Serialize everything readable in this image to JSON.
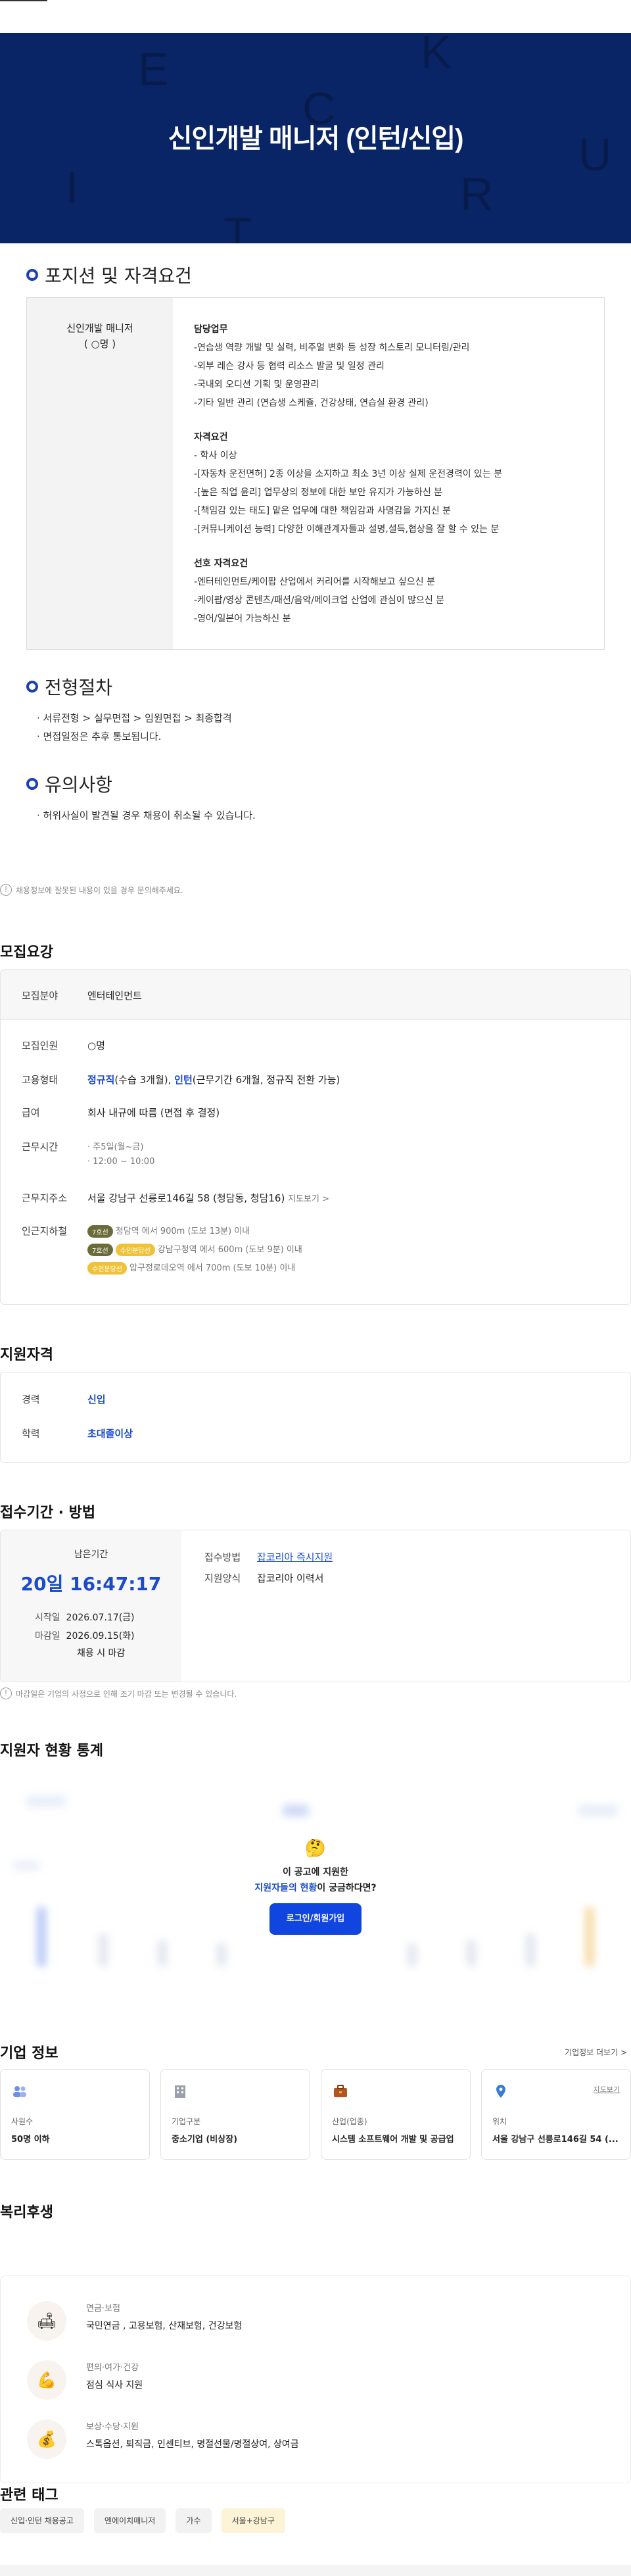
{
  "hero_title": "신인개발 매니저 (인턴/신입)",
  "hero_bg_letters": [
    "E",
    "K",
    "C",
    "U",
    "I",
    "R",
    "T"
  ],
  "sections": {
    "position": "포지션 및 자격요건",
    "process": "전형절차",
    "notice": "유의사항"
  },
  "position": {
    "name": "신인개발 매니저",
    "count": "( ○명 )",
    "duty_title": "담당업무",
    "duties": [
      "-연습생 역량 개발 및 실력, 비주얼 변화 등 성장 히스토리 모니터링/관리",
      "-외부 레슨 강사 등 협력 리소스 발굴 및 일정 관리",
      "-국내외 오디션 기획 및 운영관리",
      "-기타 일반 관리 (연습생 스케쥴, 건강상태, 연습실 환경 관리)"
    ],
    "req_title": "자격요건",
    "reqs": [
      "- 학사 이상",
      "-[자동차 운전면허] 2종 이상을 소지하고 최소 3년 이상 실제 운전경력이 있는 분",
      "-[높은 직업 윤리] 업무상의 정보에 대한 보안 유지가 가능하신 분",
      "-[책임감 있는 태도] 맡은 업무에 대한 책임감과 사명감을 가지신 분",
      "-[커뮤니케이션 능력] 다양한 이해관계자들과 설명,설득,협상을 잘 할 수 있는 분"
    ],
    "pref_title": "선호 자격요건",
    "prefs": [
      "-엔터테인먼트/케이팝 산업에서 커리어를 시작해보고 싶으신 분",
      "-케이팝/영상 콘텐츠/패션/음악/메이크업 산업에 관심이 많으신 분",
      "-영어/일본어 가능하신 분"
    ]
  },
  "process_lines": [
    "· 서류전형 > 실무면접 > 임원면접 > 최종합격",
    "· 면접일정은 추후 통보됩니다."
  ],
  "notice_lines": [
    "· 허위사실이 발견될 경우 채용이 취소될 수 있습니다."
  ],
  "report_note": "채용정보에 잘못된 내용이 있을 경우 문의해주세요.",
  "recruit": {
    "title": "모집요강",
    "field_label": "모집분야",
    "field_value": "엔터테인먼트",
    "count_label": "모집인원",
    "count_value": "○명",
    "type_label": "고용형태",
    "type_a": "정규직",
    "type_a_note": "(수습 3개월), ",
    "type_b": "인턴",
    "type_b_note": "(근무기간 6개월, 정규직 전환 가능)",
    "salary_label": "급여",
    "salary_value": "회사 내규에 따름 (면접 후 결정)",
    "time_label": "근무시간",
    "time_lines": [
      "· 주5일(월~금)",
      "· 12:00 ~ 10:00"
    ],
    "addr_label": "근무지주소",
    "addr_value": "서울 강남구 선릉로146길 58 (청담동, 청담16)",
    "map_label": "지도보기 >",
    "subway_label": "인근지하철",
    "subways": [
      {
        "badges": [
          "7호선"
        ],
        "text": "청담역 에서 900m (도보 13분) 이내"
      },
      {
        "badges": [
          "7호선",
          "수인분당선"
        ],
        "text": "강남구청역 에서 600m (도보 9분) 이내"
      },
      {
        "badges": [
          "수인분당선"
        ],
        "text": "압구정로데오역 에서 700m (도보 10분) 이내"
      }
    ]
  },
  "qual": {
    "title": "지원자격",
    "exp_label": "경력",
    "exp_value": "신입",
    "edu_label": "학력",
    "edu_value": "초대졸이상"
  },
  "apply": {
    "title": "접수기간 · 방법",
    "remain_label": "남은기간",
    "remain_value": "20일 16:47:17",
    "start_label": "시작일",
    "start_value": "2026.07.17(금)",
    "end_label": "마감일",
    "end_value": "2026.09.15(화)",
    "end_note": "채용 시 마감",
    "method_label": "접수방법",
    "method_value": "잡코리아 즉시지원",
    "form_label": "지원양식",
    "form_value": "잡코리아 이력서",
    "note": "마감일은 기업의 사정으로 인해 조기 마감 또는 변경될 수 있습니다."
  },
  "stats": {
    "title": "지원자 현황 통계",
    "emoji": "🤔",
    "line1": "이 공고에 지원한",
    "line2_blue": "지원자들의 현황",
    "line2_rest": "이 궁금하다면?",
    "cta": "로그인/회원가입"
  },
  "company": {
    "title": "기업 정보",
    "more": "기업정보 더보기 >",
    "cards": [
      {
        "icon": "people-icon",
        "label": "사원수",
        "value": "50명 이하",
        "color": "#6f8fe6"
      },
      {
        "icon": "building-icon",
        "label": "기업구분",
        "value": "중소기업 (비상장)",
        "color": "#9aa1ad"
      },
      {
        "icon": "briefcase-icon",
        "label": "산업(업종)",
        "value": "시스템 소프트웨어 개발 및 공급업",
        "color": "#b2561f"
      },
      {
        "icon": "pin-icon",
        "label": "위치",
        "value": "서울 강남구 선릉로146길 54 (...",
        "color": "#3a7bd5",
        "link": "지도보기"
      }
    ]
  },
  "welfare": {
    "title": "복리후생",
    "items": [
      {
        "icon": "🛋",
        "label": "연금·보험",
        "value": "국민연금 , 고용보험, 산재보험, 건강보험"
      },
      {
        "icon": "💪",
        "label": "편의·여가·건강",
        "value": "점심 식사 지원"
      },
      {
        "icon": "💰",
        "label": "보상·수당·지원",
        "value": "스톡옵션, 퇴직금, 인센티브, 명절선물/명절상여, 상여금"
      }
    ]
  },
  "tags": {
    "title": "관련 태그",
    "items": [
      "신입·인턴 채용공고",
      "엔에이치매니저",
      "가수",
      "서울+강남구"
    ]
  }
}
